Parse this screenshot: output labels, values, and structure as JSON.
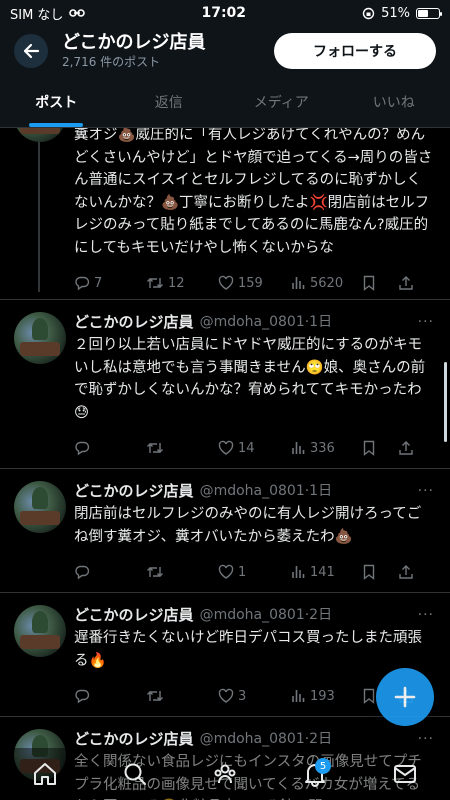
{
  "status_bar": {
    "carrier": "SIM なし",
    "time": "17:02",
    "battery": "51%",
    "battery_level": 0.51
  },
  "header": {
    "title": "どこかのレジ店員",
    "subtitle": "2,716 件のポスト",
    "follow_label": "フォローする"
  },
  "tabs": [
    {
      "label": "ポスト",
      "active": true
    },
    {
      "label": "返信",
      "active": false
    },
    {
      "label": "メディア",
      "active": false
    },
    {
      "label": "いいね",
      "active": false
    }
  ],
  "tweets": [
    {
      "name": "",
      "handle": "",
      "time": "",
      "text": "糞オジ💩威圧的に「有人レジあけてくれやんの？めんどくさいんやけど」とドヤ顔で迫ってくる→周りの皆さん普通にスイスイとセルフレジしてるのに恥ずかしくないんかな？💩丁寧にお断りしたよ💢閉店前はセルフレジのみって貼り紙までしてあるのに馬鹿なん?威圧的にしてもキモいだけやし怖くないからな",
      "replies": "7",
      "retweets": "12",
      "likes": "159",
      "views": "5620"
    },
    {
      "name": "どこかのレジ店員",
      "handle": "@mdoha_0801",
      "time": "·1日",
      "text": "２回り以上若い店員にドヤドヤ威圧的にするのがキモいし私は意地でも言う事聞きません🙄娘、奥さんの前で恥ずかしくないんかな？宥められててキモかったわ😓",
      "replies": "",
      "retweets": "",
      "likes": "14",
      "views": "336"
    },
    {
      "name": "どこかのレジ店員",
      "handle": "@mdoha_0801",
      "time": "·1日",
      "text": "閉店前はセルフレジのみやのに有人レジ開けろってごね倒す糞オジ、糞オバいたから萎えたわ💩",
      "replies": "",
      "retweets": "",
      "likes": "1",
      "views": "141"
    },
    {
      "name": "どこかのレジ店員",
      "handle": "@mdoha_0801",
      "time": "·2日",
      "text": "遅番行きたくないけど昨日デパコス買ったしまた頑張る🔥",
      "replies": "",
      "retweets": "",
      "likes": "3",
      "views": "193"
    },
    {
      "name": "どこかのレジ店員",
      "handle": "@mdoha_0801",
      "time": "·2日",
      "text": "全く関係ない食品レジにもインスタの画像見せてプチプラ化粧品の画像見せて聞いてくるバカ女が増えてるから困ってる😤化粧品売ってる館で聞いてこい",
      "replies": "",
      "retweets": "",
      "likes": "",
      "views": ""
    }
  ],
  "more_label": "···",
  "nav": {
    "notifications_badge": "5"
  },
  "colors": {
    "accent": "#1d9bf0",
    "background": "#000000",
    "muted": "#71767b"
  }
}
